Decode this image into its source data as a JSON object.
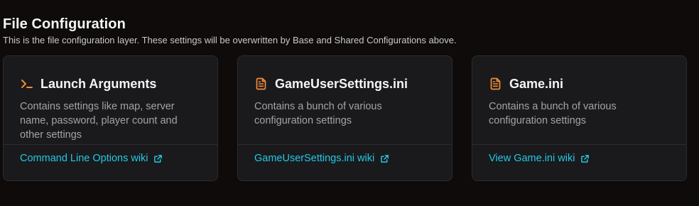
{
  "page": {
    "title": "File Configuration",
    "description": "This is the file configuration layer. These settings will be overwritten by Base and Shared Configurations above."
  },
  "colors": {
    "background": "#0e0b0a",
    "card_background": "#1a1a1c",
    "accent_icon": "#f08c3a",
    "link": "#22c8e6"
  },
  "cards": [
    {
      "icon": "terminal-icon",
      "title": "Launch Arguments",
      "description": "Contains settings like map, server name, password, player count and other settings",
      "link_label": "Command Line Options wiki",
      "link_icon": "external-link-icon"
    },
    {
      "icon": "file-text-icon",
      "title": "GameUserSettings.ini",
      "description": "Contains a bunch of various configuration settings",
      "link_label": "GameUserSettings.ini wiki",
      "link_icon": "external-link-icon"
    },
    {
      "icon": "file-text-icon",
      "title": "Game.ini",
      "description": "Contains a bunch of various configuration settings",
      "link_label": "View Game.ini wiki",
      "link_icon": "external-link-icon"
    }
  ]
}
